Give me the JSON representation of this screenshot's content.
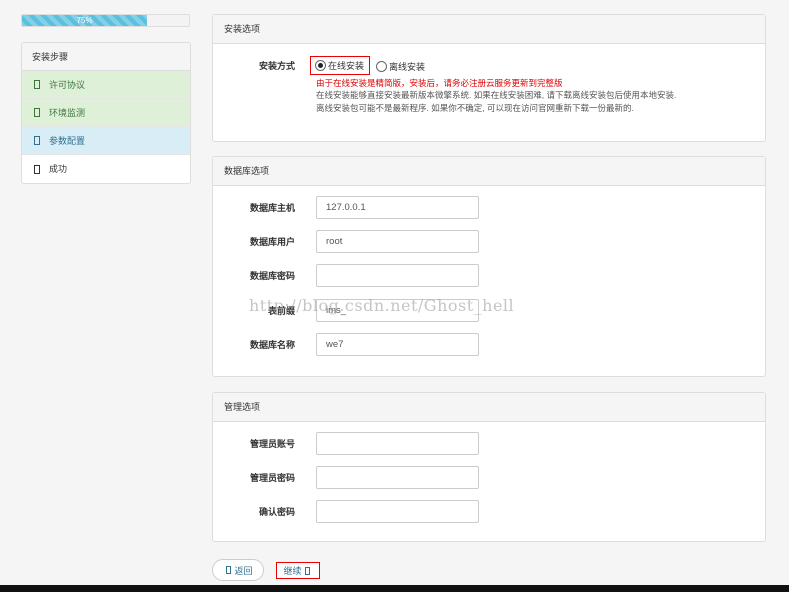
{
  "progress": {
    "label": "75%",
    "value": 0.75
  },
  "steps": {
    "title": "安装步骤",
    "items": [
      {
        "label": "许可协议",
        "state": "done"
      },
      {
        "label": "环境监测",
        "state": "done"
      },
      {
        "label": "参数配置",
        "state": "active"
      },
      {
        "label": "成功",
        "state": "pending"
      }
    ]
  },
  "install_options": {
    "title": "安装选项",
    "method_label": "安装方式",
    "online": "在线安装",
    "offline": "离线安装",
    "warning": "由于在线安装是精简版，安装后，请务必注册云服务更新到完整版",
    "note1": "在线安装能够直接安装最新版本微擎系统. 如果在线安装困难, 请下载离线安装包后使用本地安装.",
    "note2": "离线安装包可能不是最新程序. 如果你不确定, 可以现在访问官网重新下载一份最新的."
  },
  "db_options": {
    "title": "数据库选项",
    "host_label": "数据库主机",
    "host_value": "127.0.0.1",
    "user_label": "数据库用户",
    "user_value": "root",
    "pass_label": "数据库密码",
    "pass_value": "",
    "prefix_label": "表前缀",
    "prefix_value": "ims_",
    "name_label": "数据库名称",
    "name_value": "we7"
  },
  "admin_options": {
    "title": "管理选项",
    "account_label": "管理员账号",
    "password_label": "管理员密码",
    "confirm_label": "确认密码"
  },
  "buttons": {
    "back": "返回",
    "next": "继续"
  },
  "watermark": "http://blog.csdn.net/Ghost_hell"
}
